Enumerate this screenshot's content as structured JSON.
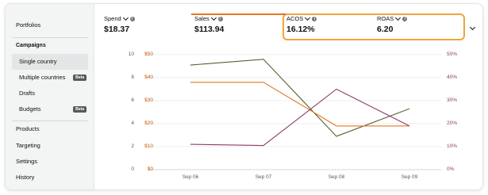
{
  "sidebar": {
    "portfolios": "Portfolios",
    "campaigns_heading": "Campaigns",
    "items": [
      {
        "label": "Single country"
      },
      {
        "label": "Multiple countries",
        "badge": "Beta"
      },
      {
        "label": "Drafts"
      },
      {
        "label": "Budgets",
        "badge": "Beta"
      }
    ],
    "products": "Products",
    "targeting": "Targeting",
    "settings": "Settings",
    "history": "History"
  },
  "metrics": [
    {
      "label": "Spend",
      "value": "$18.37",
      "color": "#6b6f3b"
    },
    {
      "label": "Sales",
      "value": "$113.94",
      "color": "#e3781d"
    },
    {
      "label": "ACOS",
      "value": "16.12%",
      "color": "#c7477f"
    },
    {
      "label": "ROAS",
      "value": "6.20",
      "color": "#c7477f"
    }
  ],
  "chart_data": {
    "type": "line",
    "x": [
      "Sep 06",
      "Sep 07",
      "Sep 08",
      "Sep 09"
    ],
    "y_left_ticks": [
      "10",
      "8",
      "6",
      "4",
      "2",
      "0"
    ],
    "y_left2_ticks": [
      "$50",
      "$40",
      "$30",
      "$20",
      "$10",
      "$0"
    ],
    "y_right_ticks": [
      "50%",
      "40%",
      "30%",
      "20%",
      "10%",
      "0%"
    ],
    "ylim_left": [
      0,
      10
    ],
    "ylim_left2": [
      0,
      50
    ],
    "ylim_right": [
      0,
      50
    ],
    "series": [
      {
        "axis": "left",
        "color": "#5a5e2f",
        "values": [
          9.1,
          9.6,
          2.9,
          5.3
        ]
      },
      {
        "axis": "left2",
        "color": "#e3781d",
        "values": [
          38,
          38,
          19,
          19
        ]
      },
      {
        "axis": "right",
        "color": "#8e3b6a",
        "values": [
          11,
          10.5,
          35,
          19
        ]
      }
    ],
    "grid": true
  }
}
